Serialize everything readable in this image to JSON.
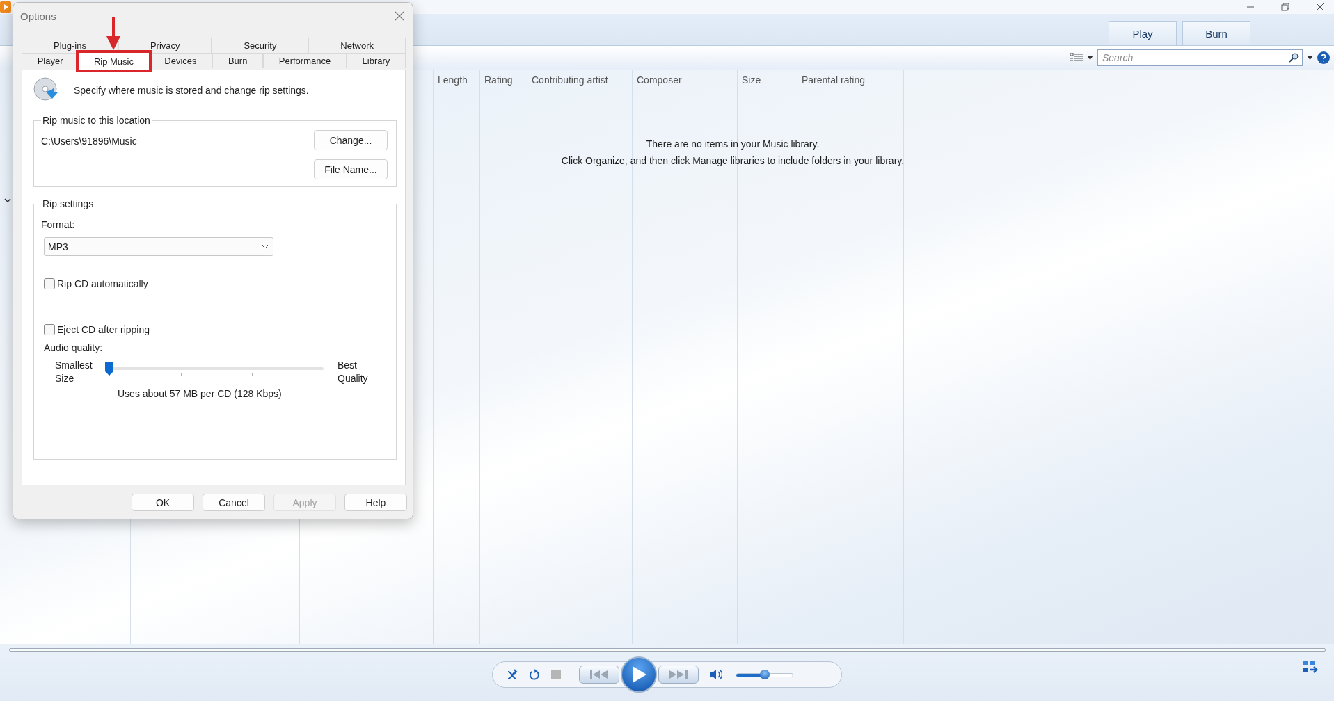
{
  "toolbar": {
    "tabs": [
      {
        "label": "Play"
      },
      {
        "label": "Burn"
      }
    ],
    "search": {
      "placeholder": "Search"
    }
  },
  "library": {
    "columns": [
      "",
      "",
      "",
      "Length",
      "Rating",
      "Contributing artist",
      "Composer",
      "Size",
      "Parental rating"
    ],
    "empty_message": [
      "There are no items in your Music library.",
      "Click Organize, and then click Manage libraries to include folders in your library."
    ]
  },
  "player": {
    "volume": {
      "level": 0.5
    }
  },
  "dialog": {
    "title": "Options",
    "tab_rows": [
      [
        {
          "label": "Plug-ins",
          "selected": false,
          "highlighted": false
        },
        {
          "label": "Privacy",
          "selected": false,
          "highlighted": false
        },
        {
          "label": "Security",
          "selected": false,
          "highlighted": false
        },
        {
          "label": "Network",
          "selected": false,
          "highlighted": false
        }
      ],
      [
        {
          "label": "Player",
          "selected": false,
          "highlighted": false
        },
        {
          "label": "Rip Music",
          "selected": true,
          "highlighted": true
        },
        {
          "label": "Devices",
          "selected": false,
          "highlighted": false
        },
        {
          "label": "Burn",
          "selected": false,
          "highlighted": false
        },
        {
          "label": "Performance",
          "selected": false,
          "highlighted": false
        },
        {
          "label": "Library",
          "selected": false,
          "highlighted": false
        }
      ]
    ],
    "header_text": "Specify where music is stored and change rip settings.",
    "location": {
      "title": "Rip music to this location",
      "path": "C:\\Users\\91896\\Music",
      "buttons": [
        "Change...",
        "File Name..."
      ]
    },
    "rip_settings": {
      "title": "Rip settings",
      "format_label": "Format:",
      "format": "MP3",
      "checkboxes": [
        {
          "label": "Rip CD automatically",
          "checked": false
        },
        {
          "label": "Eject CD after ripping",
          "checked": false
        }
      ],
      "quality": {
        "label": "Audio quality:",
        "min_label": "Smallest Size",
        "max_label": "Best Quality",
        "level": 0,
        "reading": "Uses about 57 MB per CD (128 Kbps)"
      }
    },
    "buttons": [
      {
        "label": "OK",
        "disabled": false
      },
      {
        "label": "Cancel",
        "disabled": false
      },
      {
        "label": "Apply",
        "disabled": true
      },
      {
        "label": "Help",
        "disabled": false
      }
    ]
  }
}
